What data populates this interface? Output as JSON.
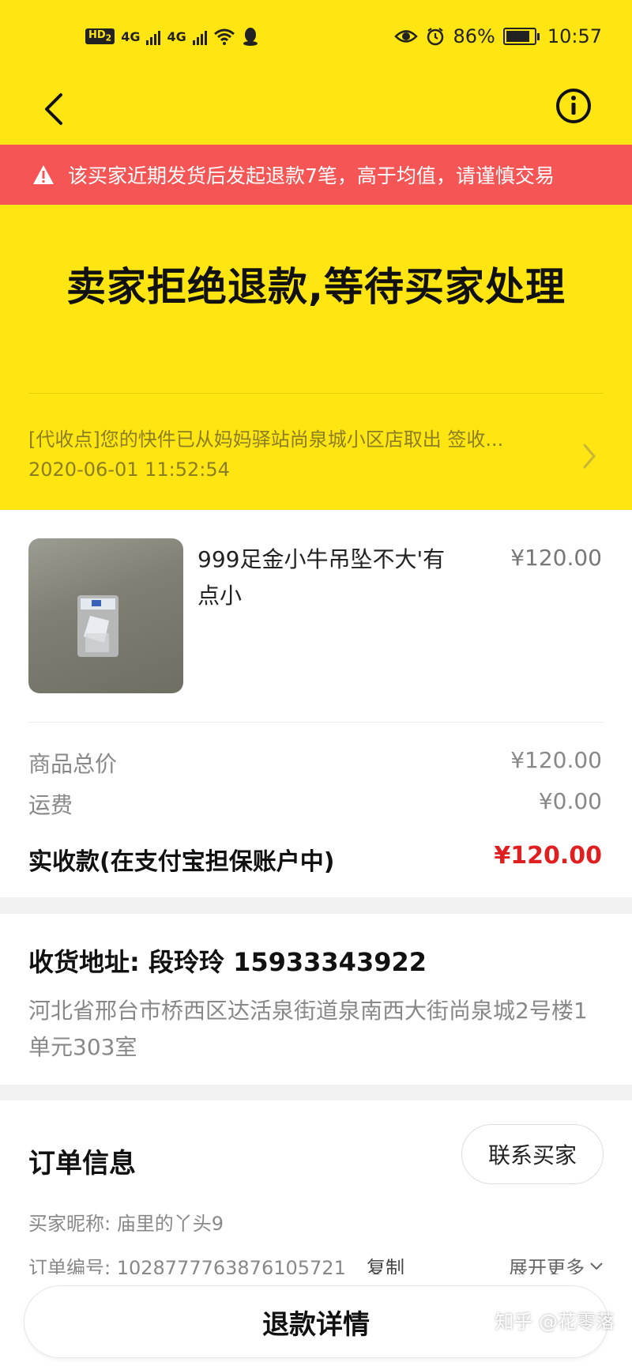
{
  "status_bar": {
    "hd": "HD",
    "hd_sub": "2",
    "net1": "4G",
    "net2": "4G",
    "battery_pct": "86%",
    "time": "10:57"
  },
  "colors": {
    "primary_yellow": "#ffe511",
    "warning_red": "#f55555",
    "price_red": "#e02020"
  },
  "warning": {
    "text": "该买家近期发货后发起退款7笔，高于均值，请谨慎交易"
  },
  "hero": {
    "title": "卖家拒绝退款,等待买家处理",
    "logistics_line1": "[代收点]您的快件已从妈妈驿站尚泉城小区店取出 签收...",
    "logistics_time": "2020-06-01 11:52:54"
  },
  "product": {
    "title": "999足金小牛吊坠不大'有点小",
    "price": "¥120.00"
  },
  "fees": {
    "goods_total_label": "商品总价",
    "goods_total_value": "¥120.00",
    "shipping_label": "运费",
    "shipping_value": "¥0.00",
    "received_label": "实收款(在支付宝担保账户中)",
    "received_value": "¥120.00"
  },
  "address": {
    "heading": "收货地址:  段玲玲  15933343922",
    "detail": "河北省邢台市桥西区达活泉街道泉南西大街尚泉城2号楼1单元303室"
  },
  "order": {
    "title": "订单信息",
    "contact_button": "联系买家",
    "nickname": "买家昵称: 庙里的丫头9",
    "order_no": "订单编号: 1028777763876105721",
    "copy": "复制",
    "expand": "展开更多"
  },
  "bottom": {
    "refund_details": "退款详情",
    "watermark": "知乎 @花零落"
  },
  "icons": {
    "back": "chevron-left",
    "info": "info-circle",
    "warning": "warning-triangle",
    "logistics_arrow": "chevron-right",
    "expand": "chevron-down"
  }
}
